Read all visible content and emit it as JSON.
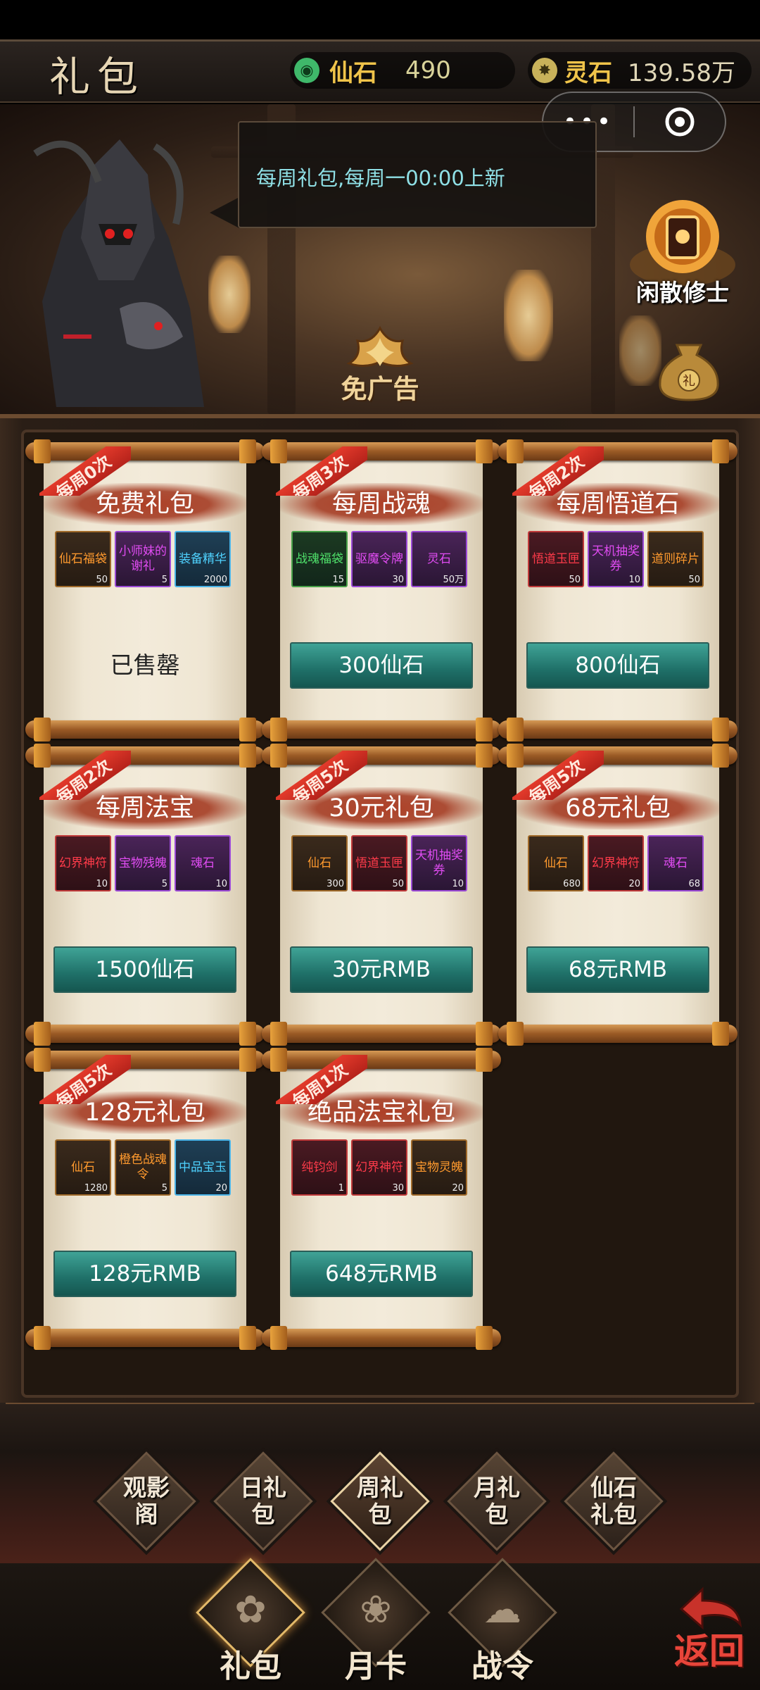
{
  "header": {
    "title": "礼包",
    "currencies": [
      {
        "icon": "jade-coin-icon",
        "name": "仙石",
        "value": "490",
        "color": "#3fb86a"
      },
      {
        "icon": "spirit-stone-icon",
        "name": "灵石",
        "value": "139.58万",
        "color": "#c8b25a"
      }
    ]
  },
  "mini_program": {
    "more": "•••",
    "close_icon": "target-icon"
  },
  "banner": {
    "notice": "每周礼包,每周一00:00上新",
    "idle_label": "闲散修士",
    "no_ad_label": "免广告"
  },
  "cards": [
    {
      "ribbon": "每周0次",
      "title": "免费礼包",
      "items": [
        {
          "name": "仙石福袋",
          "count": "50",
          "quality": "orange"
        },
        {
          "name": "小师妹的谢礼",
          "count": "5",
          "quality": "purple"
        },
        {
          "name": "装备精华",
          "count": "2000",
          "quality": "blue"
        }
      ],
      "price": "已售罄",
      "sold_out": true
    },
    {
      "ribbon": "每周3次",
      "title": "每周战魂",
      "items": [
        {
          "name": "战魂福袋",
          "count": "15",
          "quality": "green"
        },
        {
          "name": "驱魔令牌",
          "count": "30",
          "quality": "purple"
        },
        {
          "name": "灵石",
          "count": "50万",
          "quality": "purple"
        }
      ],
      "price": "300仙石"
    },
    {
      "ribbon": "每周2次",
      "title": "每周悟道石",
      "items": [
        {
          "name": "悟道玉匣",
          "count": "50",
          "quality": "red"
        },
        {
          "name": "天机抽奖券",
          "count": "10",
          "quality": "purple"
        },
        {
          "name": "道则碎片",
          "count": "50",
          "quality": "orange"
        }
      ],
      "price": "800仙石"
    },
    {
      "ribbon": "每周2次",
      "title": "每周法宝",
      "items": [
        {
          "name": "幻界神符",
          "count": "10",
          "quality": "red"
        },
        {
          "name": "宝物残魄",
          "count": "5",
          "quality": "purple"
        },
        {
          "name": "魂石",
          "count": "10",
          "quality": "purple"
        }
      ],
      "price": "1500仙石"
    },
    {
      "ribbon": "每周5次",
      "title": "30元礼包",
      "items": [
        {
          "name": "仙石",
          "count": "300",
          "quality": "orange"
        },
        {
          "name": "悟道玉匣",
          "count": "50",
          "quality": "red"
        },
        {
          "name": "天机抽奖券",
          "count": "10",
          "quality": "purple"
        }
      ],
      "price": "30元RMB"
    },
    {
      "ribbon": "每周5次",
      "title": "68元礼包",
      "items": [
        {
          "name": "仙石",
          "count": "680",
          "quality": "orange"
        },
        {
          "name": "幻界神符",
          "count": "20",
          "quality": "red"
        },
        {
          "name": "魂石",
          "count": "68",
          "quality": "purple"
        }
      ],
      "price": "68元RMB"
    },
    {
      "ribbon": "每周5次",
      "title": "128元礼包",
      "items": [
        {
          "name": "仙石",
          "count": "1280",
          "quality": "orange"
        },
        {
          "name": "橙色战魂令",
          "count": "5",
          "quality": "orange"
        },
        {
          "name": "中品宝玉",
          "count": "20",
          "quality": "blue"
        }
      ],
      "price": "128元RMB"
    },
    {
      "ribbon": "每周1次",
      "title": "绝品法宝礼包",
      "items": [
        {
          "name": "纯钧剑",
          "count": "1",
          "quality": "red"
        },
        {
          "name": "幻界神符",
          "count": "30",
          "quality": "red"
        },
        {
          "name": "宝物灵魄",
          "count": "20",
          "quality": "orange"
        }
      ],
      "price": "648元RMB"
    }
  ],
  "category_tabs": [
    {
      "label": "观影阁",
      "line1": "观影",
      "line2": "阁"
    },
    {
      "label": "日礼包",
      "line1": "日礼",
      "line2": "包"
    },
    {
      "label": "周礼包",
      "line1": "周礼",
      "line2": "包",
      "active": true
    },
    {
      "label": "月礼包",
      "line1": "月礼",
      "line2": "包"
    },
    {
      "label": "仙石礼包",
      "line1": "仙石",
      "line2": "礼包"
    }
  ],
  "bottom_nav": [
    {
      "label": "礼包",
      "icon": "gift-lantern-icon",
      "active": true
    },
    {
      "label": "月卡",
      "icon": "lotus-flame-icon"
    },
    {
      "label": "战令",
      "icon": "cloud-crest-icon"
    }
  ],
  "back_label": "返回"
}
